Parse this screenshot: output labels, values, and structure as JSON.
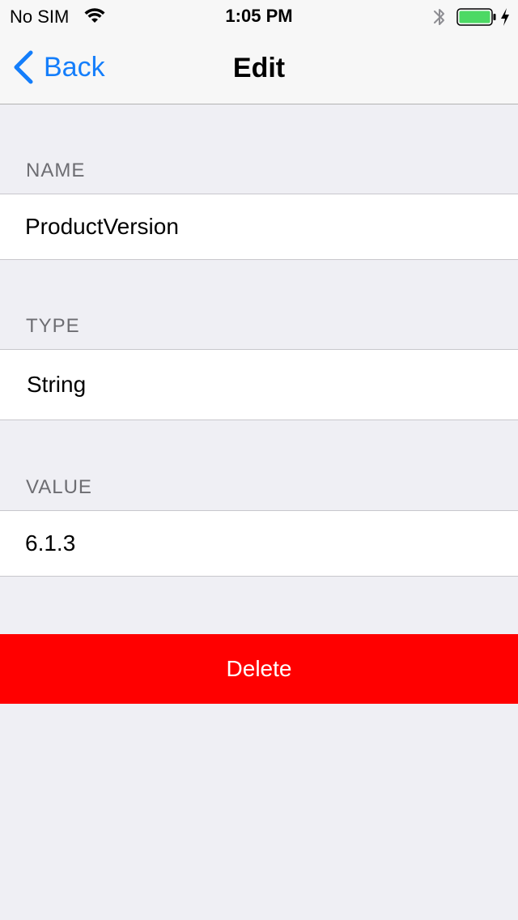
{
  "status_bar": {
    "carrier": "No SIM",
    "time": "1:05 PM",
    "battery_color": "#4cd964",
    "icons": [
      "wifi-icon",
      "bluetooth-icon",
      "battery-icon",
      "charging-bolt-icon"
    ]
  },
  "nav": {
    "back_label": "Back",
    "title": "Edit",
    "accent_color": "#147efb"
  },
  "sections": {
    "name": {
      "header": "NAME",
      "value": "ProductVersion"
    },
    "type": {
      "header": "TYPE",
      "value": "String"
    },
    "value": {
      "header": "VALUE",
      "value": "6.1.3"
    }
  },
  "actions": {
    "delete_label": "Delete",
    "delete_color": "#ff0000"
  }
}
